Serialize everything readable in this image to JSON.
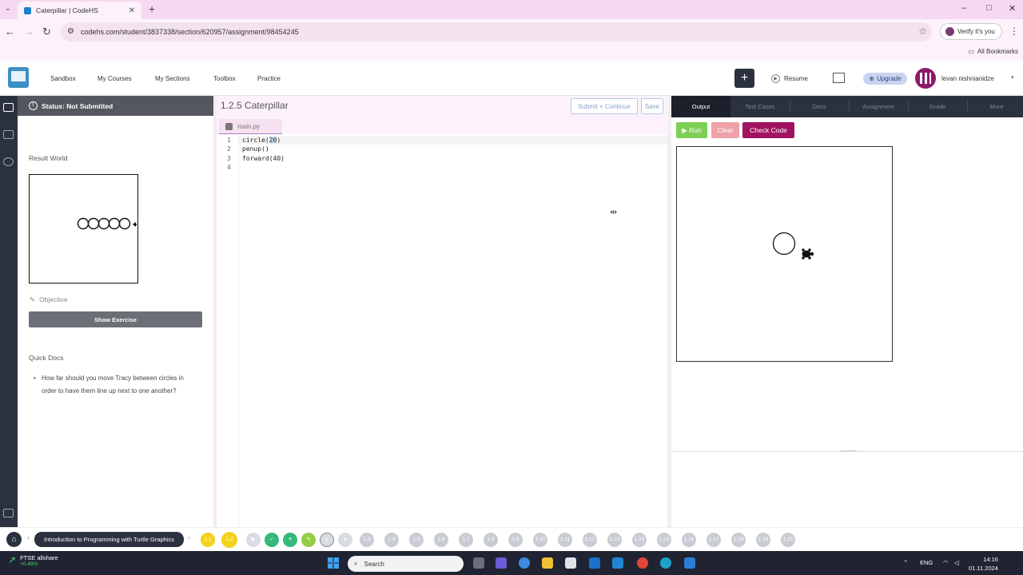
{
  "browser": {
    "tab_title": "Caterpillar | CodeHS",
    "url": "codehs.com/student/3837338/section/620957/assignment/98454245",
    "verify_label": "Verify it's you",
    "all_bookmarks": "All Bookmarks"
  },
  "site": {
    "nav": [
      "Sandbox",
      "My Courses",
      "My Sections",
      "Toolbox",
      "Practice"
    ],
    "resume_label": "Resume",
    "upgrade_label": "Upgrade",
    "username": "levan nishnianidze"
  },
  "left_panel": {
    "status": "Status: Not Submitted",
    "result_world_label": "Result World",
    "objective_label": "Objective",
    "show_exercise": "Show Exercise",
    "quick_docs_label": "Quick Docs",
    "quick_docs_item": "How far should you move Tracy between circles in order to have them line up next to one another?"
  },
  "editor": {
    "exercise_title": "1.2.5 Caterpillar",
    "submit_label": "Submit + Continue",
    "save_label": "Save",
    "file_name": "main.py",
    "line_numbers": [
      "1",
      "2",
      "3",
      "4"
    ],
    "lines": {
      "l1_pre": "circle(",
      "l1_sel": "20",
      "l1_post": ")",
      "l2": "penup()",
      "l3": "forward(40)",
      "l4": ""
    }
  },
  "right_panel": {
    "tabs": [
      "Output",
      "Test Cases",
      "Docs",
      "Assignment",
      "Grade",
      "More"
    ],
    "run_label": "Run",
    "clear_label": "Clear",
    "check_label": "Check Code"
  },
  "bottom_bar": {
    "course": "Introduction to Programming with Turtle Graphics",
    "lessons": [
      "1.1",
      "1.2",
      "1.3",
      "1.4",
      "1.5",
      "1.6",
      "1.7",
      "1.8",
      "1.9",
      "1.10",
      "1.11",
      "1.12",
      "1.13",
      "1.14",
      "1.15",
      "1.16",
      "1.17",
      "1.18",
      "1.19",
      "1.20"
    ]
  },
  "taskbar": {
    "stock_name": "FTSE allshare",
    "stock_change": "+0.49%",
    "search_label": "Search",
    "lang": "ENG",
    "time": "14:16",
    "date": "01.11.2024"
  },
  "colors": {
    "run": "#7dcf55",
    "clear": "#f0a0a8",
    "check_code": "#a0135f",
    "dark_nav": "#2c3140"
  }
}
